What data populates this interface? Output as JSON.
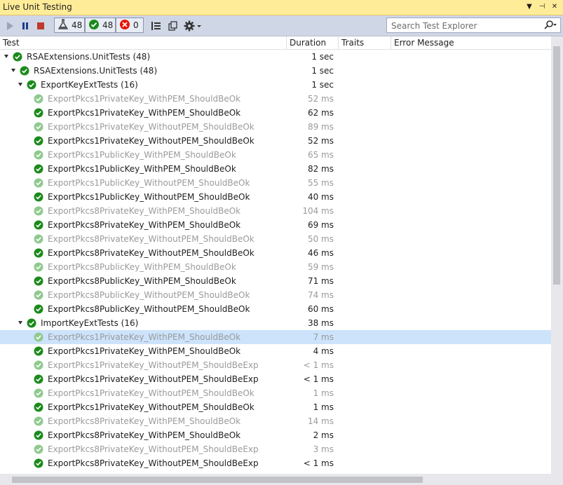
{
  "window": {
    "title": "Live Unit Testing"
  },
  "toolbar": {
    "counters": {
      "total": "48",
      "passed": "48",
      "failed": "0"
    }
  },
  "search": {
    "placeholder": "Search Test Explorer"
  },
  "columns": [
    "Test",
    "Duration",
    "Traits",
    "Error Message"
  ],
  "rows": [
    {
      "name": "RSAExtensions.UnitTests (48)",
      "duration": "1 sec",
      "level": 0,
      "expander": true,
      "stale": false
    },
    {
      "name": "RSAExtensions.UnitTests (48)",
      "duration": "1 sec",
      "level": 1,
      "expander": true,
      "stale": false
    },
    {
      "name": "ExportKeyExtTests (16)",
      "duration": "1 sec",
      "level": 2,
      "expander": true,
      "stale": false
    },
    {
      "name": "ExportPkcs1PrivateKey_WithPEM_ShouldBeOk",
      "duration": "52 ms",
      "level": 3,
      "expander": false,
      "stale": true
    },
    {
      "name": "ExportPkcs1PrivateKey_WithPEM_ShouldBeOk",
      "duration": "62 ms",
      "level": 3,
      "expander": false,
      "stale": false
    },
    {
      "name": "ExportPkcs1PrivateKey_WithoutPEM_ShouldBeOk",
      "duration": "89 ms",
      "level": 3,
      "expander": false,
      "stale": true
    },
    {
      "name": "ExportPkcs1PrivateKey_WithoutPEM_ShouldBeOk",
      "duration": "52 ms",
      "level": 3,
      "expander": false,
      "stale": false
    },
    {
      "name": "ExportPkcs1PublicKey_WithPEM_ShouldBeOk",
      "duration": "65 ms",
      "level": 3,
      "expander": false,
      "stale": true
    },
    {
      "name": "ExportPkcs1PublicKey_WithPEM_ShouldBeOk",
      "duration": "82 ms",
      "level": 3,
      "expander": false,
      "stale": false
    },
    {
      "name": "ExportPkcs1PublicKey_WithoutPEM_ShouldBeOk",
      "duration": "55 ms",
      "level": 3,
      "expander": false,
      "stale": true
    },
    {
      "name": "ExportPkcs1PublicKey_WithoutPEM_ShouldBeOk",
      "duration": "40 ms",
      "level": 3,
      "expander": false,
      "stale": false
    },
    {
      "name": "ExportPkcs8PrivateKey_WithPEM_ShouldBeOk",
      "duration": "104 ms",
      "level": 3,
      "expander": false,
      "stale": true
    },
    {
      "name": "ExportPkcs8PrivateKey_WithPEM_ShouldBeOk",
      "duration": "69 ms",
      "level": 3,
      "expander": false,
      "stale": false
    },
    {
      "name": "ExportPkcs8PrivateKey_WithoutPEM_ShouldBeOk",
      "duration": "50 ms",
      "level": 3,
      "expander": false,
      "stale": true
    },
    {
      "name": "ExportPkcs8PrivateKey_WithoutPEM_ShouldBeOk",
      "duration": "46 ms",
      "level": 3,
      "expander": false,
      "stale": false
    },
    {
      "name": "ExportPkcs8PublicKey_WithPEM_ShouldBeOk",
      "duration": "59 ms",
      "level": 3,
      "expander": false,
      "stale": true
    },
    {
      "name": "ExportPkcs8PublicKey_WithPEM_ShouldBeOk",
      "duration": "71 ms",
      "level": 3,
      "expander": false,
      "stale": false
    },
    {
      "name": "ExportPkcs8PublicKey_WithoutPEM_ShouldBeOk",
      "duration": "74 ms",
      "level": 3,
      "expander": false,
      "stale": true
    },
    {
      "name": "ExportPkcs8PublicKey_WithoutPEM_ShouldBeOk",
      "duration": "60 ms",
      "level": 3,
      "expander": false,
      "stale": false
    },
    {
      "name": "ImportKeyExtTests (16)",
      "duration": "38 ms",
      "level": 2,
      "expander": true,
      "stale": false
    },
    {
      "name": "ExportPkcs1PrivateKey_WithPEM_ShouldBeOk",
      "duration": "7 ms",
      "level": 3,
      "expander": false,
      "stale": true,
      "selected": true
    },
    {
      "name": "ExportPkcs1PrivateKey_WithPEM_ShouldBeOk",
      "duration": "4 ms",
      "level": 3,
      "expander": false,
      "stale": false
    },
    {
      "name": "ExportPkcs1PrivateKey_WithoutPEM_ShouldBeExp",
      "duration": "< 1 ms",
      "level": 3,
      "expander": false,
      "stale": true
    },
    {
      "name": "ExportPkcs1PrivateKey_WithoutPEM_ShouldBeExp",
      "duration": "< 1 ms",
      "level": 3,
      "expander": false,
      "stale": false
    },
    {
      "name": "ExportPkcs1PrivateKey_WithoutPEM_ShouldBeOk",
      "duration": "1 ms",
      "level": 3,
      "expander": false,
      "stale": true
    },
    {
      "name": "ExportPkcs1PrivateKey_WithoutPEM_ShouldBeOk",
      "duration": "1 ms",
      "level": 3,
      "expander": false,
      "stale": false
    },
    {
      "name": "ExportPkcs8PrivateKey_WithPEM_ShouldBeOk",
      "duration": "14 ms",
      "level": 3,
      "expander": false,
      "stale": true
    },
    {
      "name": "ExportPkcs8PrivateKey_WithPEM_ShouldBeOk",
      "duration": "2 ms",
      "level": 3,
      "expander": false,
      "stale": false
    },
    {
      "name": "ExportPkcs8PrivateKey_WithoutPEM_ShouldBeExp",
      "duration": "3 ms",
      "level": 3,
      "expander": false,
      "stale": true
    },
    {
      "name": "ExportPkcs8PrivateKey_WithoutPEM_ShouldBeExp",
      "duration": "< 1 ms",
      "level": 3,
      "expander": false,
      "stale": false
    }
  ],
  "colors": {
    "pass": "#1a8a1a",
    "pass_stale": "#8fc98f",
    "fail": "#e51400",
    "title_bg": "#ffec99",
    "toolbar_bg": "#cfd6e5",
    "selection": "#cce3fb"
  }
}
